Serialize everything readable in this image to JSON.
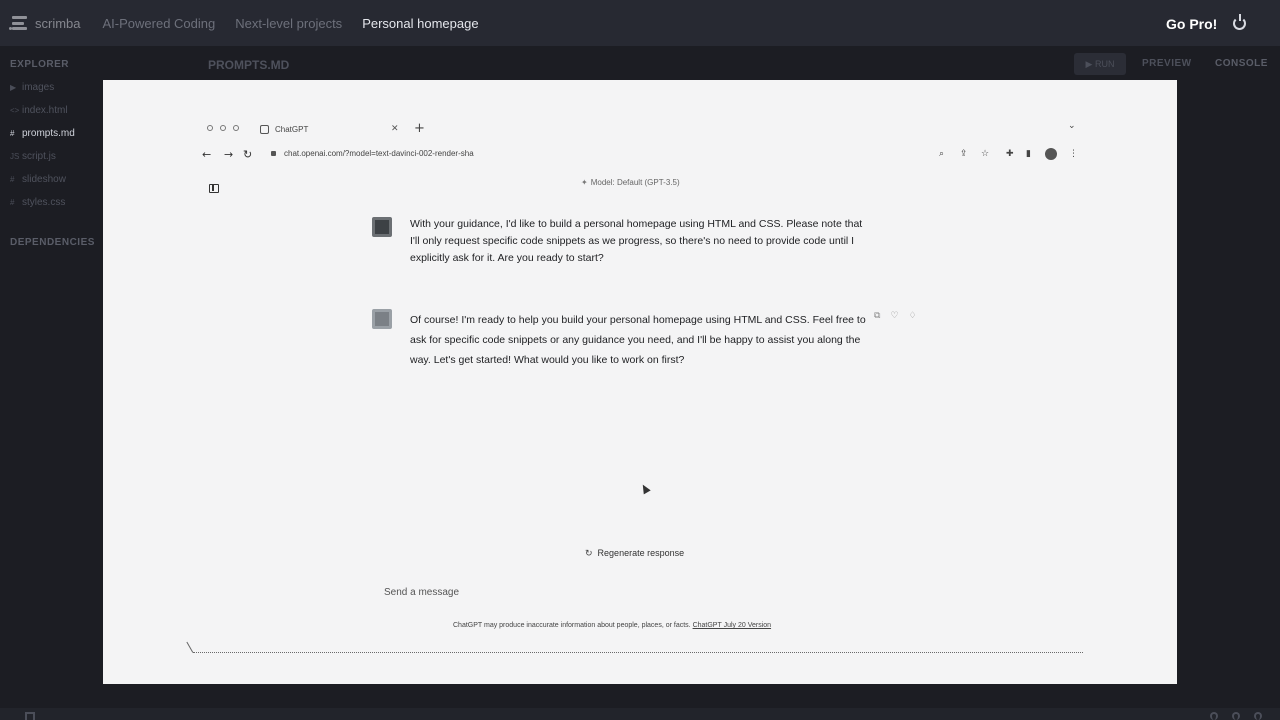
{
  "app": {
    "logo_text": "scrimba",
    "breadcrumbs": [
      "AI-Powered Coding",
      "Next-level projects",
      "Personal homepage"
    ],
    "go_pro": "Go Pro!"
  },
  "explorer": {
    "title": "EXPLORER",
    "files": [
      {
        "icon": "▶",
        "name": "images",
        "kind": "folder"
      },
      {
        "icon": "<>",
        "name": "index.html",
        "kind": "file"
      },
      {
        "icon": "#",
        "name": "prompts.md",
        "kind": "file",
        "active": true
      },
      {
        "icon": "JS",
        "name": "script.js",
        "kind": "file"
      },
      {
        "icon": "#",
        "name": "slideshow",
        "kind": "file"
      },
      {
        "icon": "#",
        "name": "styles.css",
        "kind": "file"
      }
    ],
    "dependencies": "DEPENDENCIES"
  },
  "editor": {
    "open_file": "PROMPTS.MD",
    "run": "▶ RUN",
    "preview": "PREVIEW",
    "console": "CONSOLE"
  },
  "browser": {
    "tab_title": "ChatGPT",
    "url": "chat.openai.com/?model=text-davinci-002-render-sha",
    "model": "Model: Default (GPT-3.5)"
  },
  "chat": {
    "messages": [
      {
        "role": "user",
        "text": "With your guidance, I'd like to build a personal homepage using HTML and CSS. Please note that I'll only request specific code snippets as we progress, so there's no need to provide code until I explicitly ask for it. Are you ready to start?"
      },
      {
        "role": "assistant",
        "text": "Of course! I'm ready to help you build your personal homepage using HTML and CSS. Feel free to ask for specific code snippets or any guidance you need, and I'll be happy to assist you along the way. Let's get started! What would you like to work on first?"
      }
    ],
    "regenerate": "Regenerate response",
    "input_placeholder": "Send a message",
    "disclaimer": "ChatGPT may produce inaccurate information about people, places, or facts.",
    "version_link": "ChatGPT July 20 Version"
  },
  "icons": {
    "power": "power-icon",
    "sidebar_toggle": "sidebar-toggle-icon",
    "regenerate": "refresh-icon"
  }
}
